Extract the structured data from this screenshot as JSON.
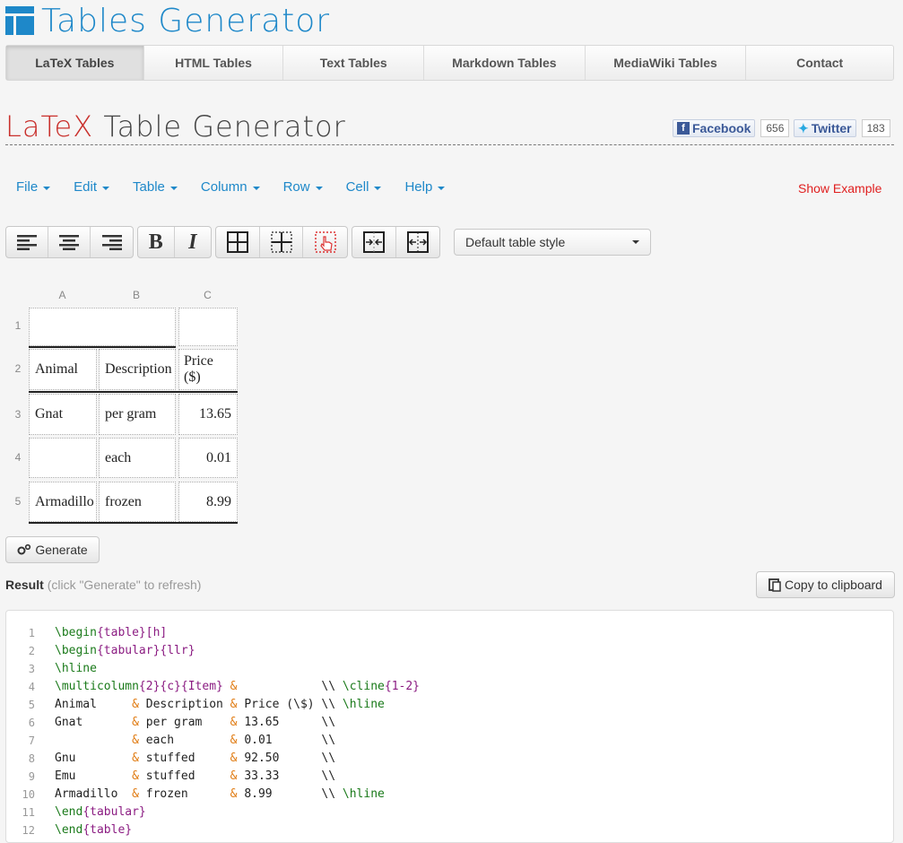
{
  "logo": {
    "text": "Tables Generator"
  },
  "nav": {
    "items": [
      {
        "label": "LaTeX Tables",
        "active": true
      },
      {
        "label": "HTML Tables",
        "active": false
      },
      {
        "label": "Text Tables",
        "active": false
      },
      {
        "label": "Markdown Tables",
        "active": false
      },
      {
        "label": "MediaWiki Tables",
        "active": false
      },
      {
        "label": "Contact",
        "active": false
      }
    ]
  },
  "heading": {
    "latex": "LaTeX",
    "rest": " Table Generator"
  },
  "social": {
    "facebook": {
      "label": "Facebook",
      "count": "656"
    },
    "twitter": {
      "label": "Twitter",
      "count": "183"
    }
  },
  "menu": {
    "items": [
      "File",
      "Edit",
      "Table",
      "Column",
      "Row",
      "Cell",
      "Help"
    ],
    "show_example": "Show Example"
  },
  "toolbar": {
    "groups": [
      [
        "align-left-icon",
        "align-center-icon",
        "align-right-icon"
      ],
      [
        "bold-icon",
        "italic-icon"
      ],
      [
        "all-borders-icon",
        "inner-borders-icon",
        "border-pick-icon"
      ],
      [
        "merge-cells-icon",
        "split-cells-icon"
      ]
    ],
    "bold": "B",
    "italic": "I",
    "style_select": "Default table style"
  },
  "editor": {
    "columns": [
      "A",
      "B",
      "C"
    ],
    "rows": [
      "1",
      "2",
      "3",
      "4",
      "5"
    ],
    "cells": {
      "r1": [
        "",
        ""
      ],
      "r2": [
        "Animal",
        "Description",
        "Price ($)"
      ],
      "r3": [
        "Gnat",
        "per gram",
        "13.65"
      ],
      "r4": [
        "",
        "each",
        "0.01"
      ],
      "r5": [
        "Armadillo",
        "frozen",
        "8.99"
      ]
    }
  },
  "generate": {
    "label": "Generate"
  },
  "result": {
    "label": "Result",
    "hint": "(click \"Generate\" to refresh)"
  },
  "copy": {
    "label": "Copy to clipboard"
  },
  "code": {
    "line_numbers": [
      "1",
      "2",
      "3",
      "4",
      "5",
      "6",
      "7",
      "8",
      "9",
      "10",
      "11",
      "12"
    ]
  },
  "colors": {
    "brand": "#1e88c9",
    "latex_red": "#c9302c",
    "show_example": "#e02020"
  }
}
